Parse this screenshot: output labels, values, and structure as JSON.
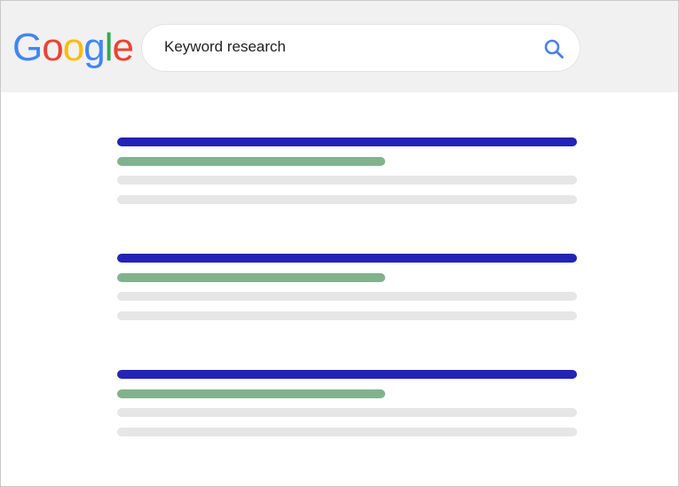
{
  "header": {
    "logo": {
      "letters": [
        {
          "char": "G",
          "color": "#4285F4"
        },
        {
          "char": "o",
          "color": "#EA4335"
        },
        {
          "char": "o",
          "color": "#FBBC05"
        },
        {
          "char": "g",
          "color": "#4285F4"
        },
        {
          "char": "l",
          "color": "#34A853"
        },
        {
          "char": "e",
          "color": "#EA4335"
        }
      ]
    },
    "search": {
      "value": "Keyword research",
      "icon": "search-icon",
      "icon_color": "#4a80e6"
    }
  },
  "results": {
    "count": 3,
    "colors": {
      "title": "#2323b5",
      "url": "#82b28d",
      "snippet": "#e6e6e6"
    }
  }
}
